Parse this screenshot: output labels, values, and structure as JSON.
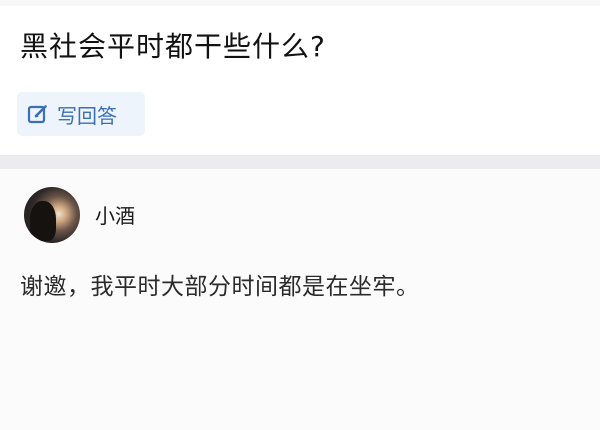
{
  "question": {
    "title": "黑社会平时都干些什么?"
  },
  "actions": {
    "write_answer_label": "写回答",
    "write_answer_icon": "edit-icon",
    "accent_color": "#3b6fb5"
  },
  "answer": {
    "author": {
      "name": "小酒",
      "avatar_icon": "avatar"
    },
    "content": "谢邀，我平时大部分时间都是在坐牢。"
  }
}
